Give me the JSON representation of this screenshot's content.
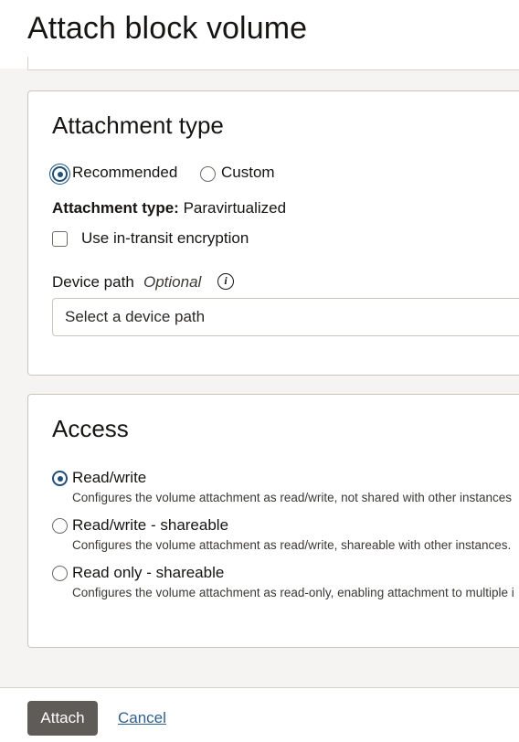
{
  "header": {
    "title": "Attach block volume"
  },
  "attachment": {
    "section_title": "Attachment type",
    "options": [
      {
        "label": "Recommended",
        "selected": true
      },
      {
        "label": "Custom",
        "selected": false
      }
    ],
    "type_label": "Attachment type:",
    "type_value": "Paravirtualized",
    "encryption_label": "Use in-transit encryption",
    "encryption_checked": false,
    "device_path_label": "Device path",
    "device_path_optional": "Optional",
    "device_path_info_icon": "info-icon",
    "device_path_placeholder": "Select a device path"
  },
  "access": {
    "section_title": "Access",
    "options": [
      {
        "label": "Read/write",
        "description": "Configures the volume attachment as read/write, not shared with other instances",
        "selected": true
      },
      {
        "label": "Read/write - shareable",
        "description": "Configures the volume attachment as read/write, shareable with other instances.",
        "selected": false
      },
      {
        "label": "Read only - shareable",
        "description": "Configures the volume attachment as read-only, enabling attachment to multiple i",
        "selected": false
      }
    ]
  },
  "footer": {
    "attach_label": "Attach",
    "cancel_label": "Cancel"
  },
  "colors": {
    "primary_button": "#5f5b56",
    "radio_selected": "#1f4f7a",
    "link": "#2f5f8a"
  }
}
